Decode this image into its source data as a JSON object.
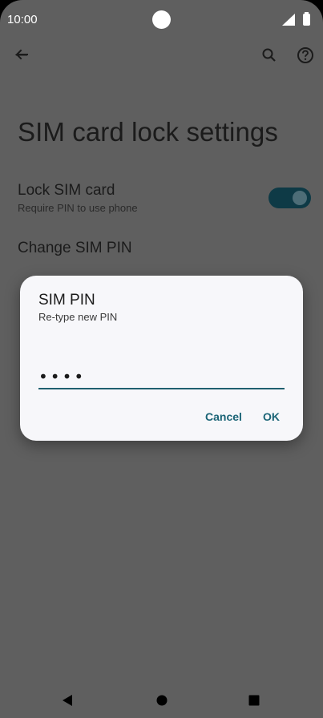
{
  "status_bar": {
    "time": "10:00"
  },
  "page": {
    "title": "SIM card lock settings"
  },
  "lock_setting": {
    "title": "Lock SIM card",
    "subtitle": "Require PIN to use phone",
    "enabled": true
  },
  "change_pin": {
    "label": "Change SIM PIN"
  },
  "dialog": {
    "title": "SIM PIN",
    "subtitle": "Re-type new PIN",
    "pin_value": "••••",
    "cancel_label": "Cancel",
    "ok_label": "OK"
  },
  "icons": {
    "back": "arrow-back-icon",
    "search": "search-icon",
    "help": "help-icon",
    "nav_back": "triangle-back-icon",
    "nav_home": "circle-home-icon",
    "nav_recents": "square-recents-icon"
  },
  "colors": {
    "scrim_background": "#5f5f5f",
    "dialog_background": "#f7f7fa",
    "accent": "#1b6476",
    "toggle_track": "#0e3a46"
  }
}
